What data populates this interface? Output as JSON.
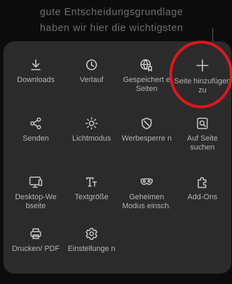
{
  "background": {
    "line1": "gute Entscheidungsgrundlage",
    "line2": "haben wir hier die wichtigsten"
  },
  "menu": {
    "items": [
      {
        "label": "Downloads",
        "icon": "download-icon"
      },
      {
        "label": "Verlauf",
        "icon": "history-clock-icon"
      },
      {
        "label": "Gespeichert e Seiten",
        "icon": "saved-pages-globe-icon"
      },
      {
        "label": "Seite hinzufügen zu",
        "icon": "plus-icon"
      },
      {
        "label": "Senden",
        "icon": "share-icon"
      },
      {
        "label": "Lichtmodus",
        "icon": "sun-icon"
      },
      {
        "label": "Werbesperre n",
        "icon": "block-icon"
      },
      {
        "label": "Auf Seite suchen",
        "icon": "find-in-page-icon"
      },
      {
        "label": "Desktop-We bseite",
        "icon": "desktop-icon"
      },
      {
        "label": "Textgröße",
        "icon": "text-size-icon"
      },
      {
        "label": "Geheimen Modus einsch.",
        "icon": "incognito-mask-icon"
      },
      {
        "label": "Add-Ons",
        "icon": "puzzle-icon"
      },
      {
        "label": "Drucken/ PDF",
        "icon": "print-icon"
      },
      {
        "label": "Einstellunge n",
        "icon": "gear-icon"
      }
    ]
  },
  "colors": {
    "panel": "#2b2b2b",
    "icon": "#c8c8c8",
    "label": "#b5b5b5",
    "highlight": "#e3161b"
  }
}
